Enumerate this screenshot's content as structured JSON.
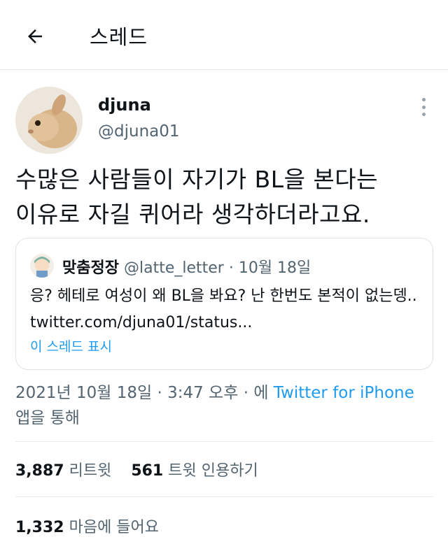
{
  "header": {
    "title": "스레드",
    "back_icon": "arrow-left-icon"
  },
  "author": {
    "name": "djuna",
    "handle": "@djuna01"
  },
  "tweet": {
    "text": "수많은 사람들이 자기가 BL을 본다는\n이유로 자길 퀴어라 생각하더라고요."
  },
  "quote": {
    "name": "맞춤정장",
    "handle": "@latte_letter",
    "separator": " · ",
    "date": "10월 18일",
    "text": "응? 헤테로 여성이 왜 BL을 봐요? 난 한번도 본적이 없는뎅.. twitter.com/djuna01/status...",
    "show_thread": "이 스레드 표시"
  },
  "meta": {
    "timestamp": "2021년 10월 18일 · 3:47 오후 · 에 ",
    "source": "Twitter for iPhone",
    "suffix": "앱을 통해"
  },
  "stats": {
    "retweets": "3,887",
    "retweets_label": "리트윗",
    "quotes": "561",
    "quotes_label": "트윗 인용하기",
    "likes": "1,332",
    "likes_label": "마음에 들어요"
  },
  "colors": {
    "accent": "#1d9bf0",
    "text": "#0f1419",
    "muted": "#536471"
  }
}
